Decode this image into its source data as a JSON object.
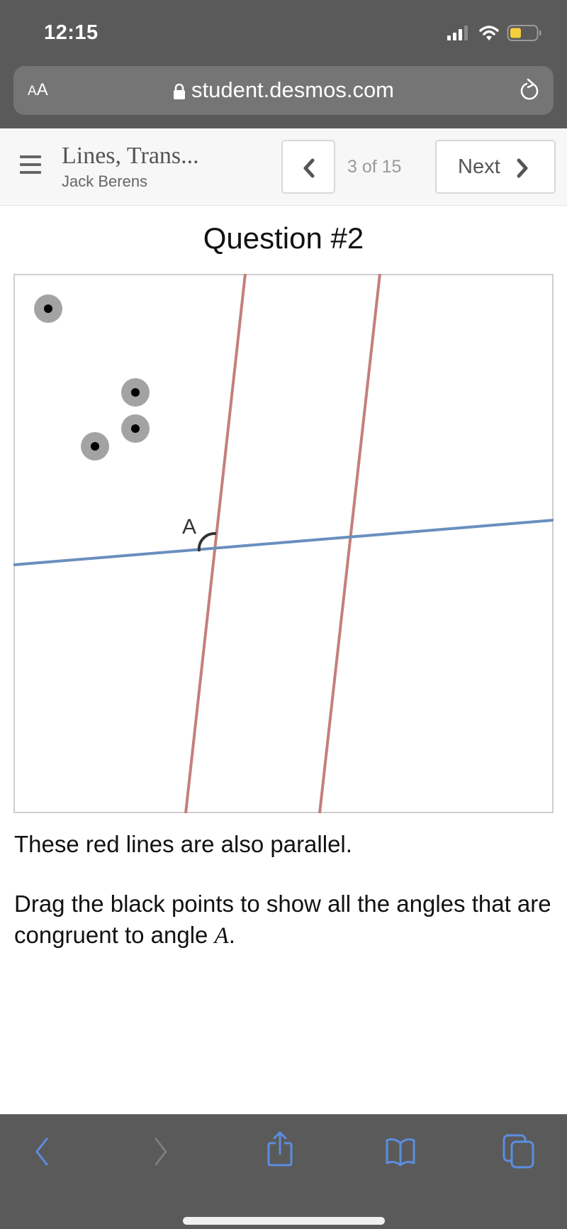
{
  "status_bar": {
    "time": "12:15",
    "icons": [
      "cellular-signal-icon",
      "wifi-icon",
      "battery-icon"
    ],
    "battery_color": "#f5cf3c"
  },
  "browser": {
    "text_size_label_small": "A",
    "text_size_label_large": "A",
    "url": "student.desmos.com",
    "lock_icon": "lock-icon",
    "reload_icon": "reload-icon"
  },
  "activity_nav": {
    "menu_icon": "hamburger-menu-icon",
    "title": "Lines, Trans...",
    "author": "Jack Berens",
    "prev_icon": "chevron-left-icon",
    "page_indicator": "3 of 15",
    "next_label": "Next",
    "next_icon": "chevron-right-icon"
  },
  "question": {
    "title": "Question #2",
    "graph": {
      "angle_label": "A",
      "colors": {
        "parallel_lines": "#c47f7b",
        "transversal": "#6a8fbd",
        "point_halo": "#a3a3a3",
        "point": "#000000",
        "angle_arc": "#333333"
      },
      "draggable_points_count": 4
    },
    "prompt_1": "These red lines are also parallel.",
    "prompt_2_before": "Drag the black points to show all the angles that are congruent to angle ",
    "prompt_2_math": "A",
    "prompt_2_after": "."
  },
  "safari_toolbar": {
    "items": [
      {
        "name": "back-icon",
        "enabled": true
      },
      {
        "name": "forward-icon",
        "enabled": false
      },
      {
        "name": "share-icon",
        "enabled": true
      },
      {
        "name": "bookmarks-icon",
        "enabled": true
      },
      {
        "name": "tabs-icon",
        "enabled": true
      }
    ],
    "accent": "#5b8ee0",
    "disabled": "#7d7d7d"
  }
}
